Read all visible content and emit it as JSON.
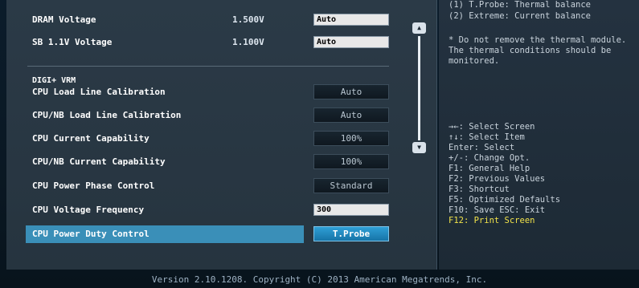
{
  "rows": [
    {
      "label": "DRAM Voltage",
      "value": "1.500V",
      "control": "field",
      "setting": "Auto"
    },
    {
      "label": "SB 1.1V Voltage",
      "value": "1.100V",
      "control": "field",
      "setting": "Auto"
    }
  ],
  "section_title": "DIGI+ VRM",
  "vrm_rows": [
    {
      "label": "CPU Load Line Calibration",
      "setting": "Auto",
      "control": "button"
    },
    {
      "label": "CPU/NB Load Line Calibration",
      "setting": "Auto",
      "control": "button"
    },
    {
      "label": "CPU Current Capability",
      "setting": "100%",
      "control": "button"
    },
    {
      "label": "CPU/NB Current Capability",
      "setting": "100%",
      "control": "button"
    },
    {
      "label": "CPU Power Phase Control",
      "setting": "Standard",
      "control": "button"
    },
    {
      "label": "CPU Voltage Frequency",
      "setting": "300",
      "control": "field"
    },
    {
      "label": "CPU Power Duty Control",
      "setting": "T.Probe",
      "control": "button",
      "selected": true
    }
  ],
  "scroll": {
    "up": "▲",
    "down": "▼"
  },
  "help": {
    "desc": [
      "(1) T.Probe: Thermal balance",
      "(2) Extreme: Current balance",
      "",
      "* Do not remove the thermal module.",
      "The thermal conditions should be",
      "monitored."
    ],
    "keys": [
      "→←: Select Screen",
      "↑↓: Select Item",
      "Enter: Select",
      "+/-: Change Opt.",
      "F1: General Help",
      "F2: Previous Values",
      "F3: Shortcut",
      "F5: Optimized Defaults",
      "F10: Save  ESC: Exit",
      "F12: Print Screen"
    ]
  },
  "footer": "Version 2.10.1208. Copyright (C) 2013 American Megatrends, Inc."
}
